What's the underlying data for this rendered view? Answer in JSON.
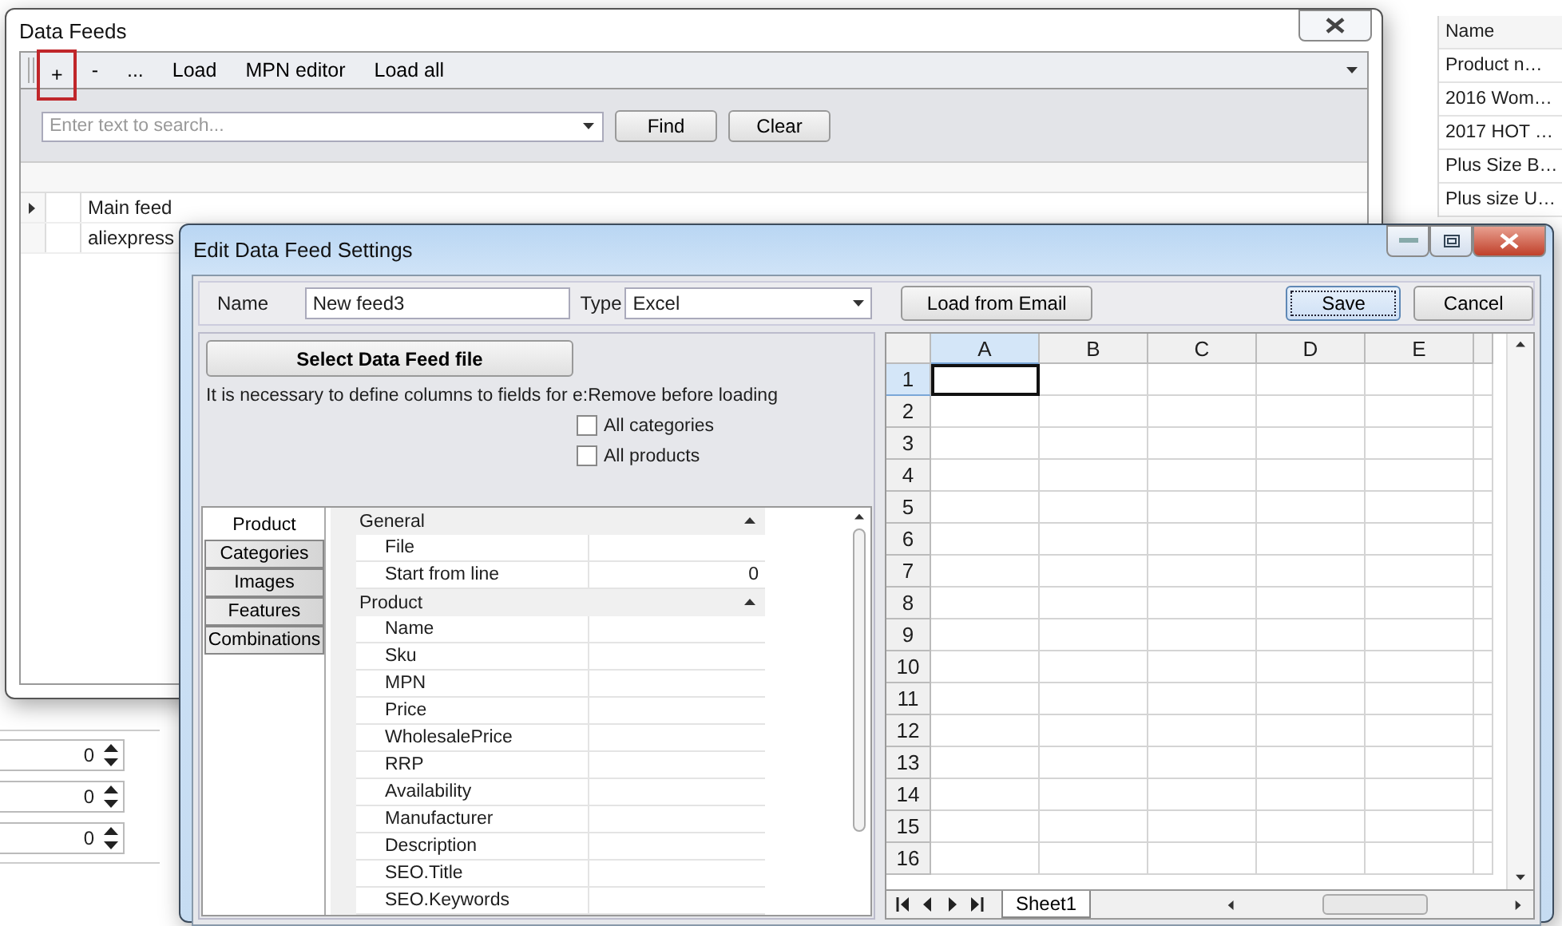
{
  "background": {
    "table": {
      "header": "Name",
      "cells": [
        "Product n…",
        "2016 Wom…",
        "2017 HOT …",
        "Plus Size B…",
        "Plus size U…"
      ]
    },
    "spinners": [
      {
        "value": "0"
      },
      {
        "value": "0"
      },
      {
        "value": "0"
      }
    ]
  },
  "data_feeds": {
    "title": "Data Feeds",
    "toolbar": [
      {
        "label": "+",
        "highlighted": true
      },
      {
        "label": "-",
        "highlighted": false
      },
      {
        "label": "...",
        "highlighted": false
      },
      {
        "label": "Load",
        "highlighted": false
      },
      {
        "label": "MPN editor",
        "highlighted": false
      },
      {
        "label": "Load all",
        "highlighted": false
      }
    ],
    "search": {
      "placeholder": "Enter text to search..."
    },
    "buttons": [
      "Find",
      "Clear"
    ],
    "rows": [
      {
        "name": "Main feed",
        "current": true
      },
      {
        "name": "aliexpress",
        "current": false
      }
    ]
  },
  "edit_window": {
    "title": "Edit Data Feed Settings",
    "name_label": "Name",
    "name_value": "New feed3",
    "type_label": "Type",
    "type_value": "Excel",
    "buttons": [
      {
        "label": "Load from Email",
        "focused": false
      },
      {
        "label": "Save",
        "focused": true
      },
      {
        "label": "Cancel",
        "focused": false
      }
    ],
    "select_file_button": "Select Data Feed file",
    "notice": "It is necessary to define columns to fields for e:",
    "remove_label": "Remove before loading",
    "checkboxes": [
      {
        "label": "All categories",
        "checked": false
      },
      {
        "label": "All products",
        "checked": false
      }
    ],
    "tabs": [
      {
        "label": "Product",
        "selected": true
      },
      {
        "label": "Categories",
        "selected": false
      },
      {
        "label": "Images",
        "selected": false
      },
      {
        "label": "Features",
        "selected": false
      },
      {
        "label": "Combinations",
        "selected": false
      }
    ],
    "property_groups": [
      {
        "title": "General",
        "expanded": true,
        "rows": [
          {
            "name": "File"
          },
          {
            "name": "Start from line",
            "value": "0"
          }
        ]
      },
      {
        "title": "Product",
        "expanded": true,
        "rows": [
          {
            "name": "Name"
          },
          {
            "name": "Sku"
          },
          {
            "name": "MPN"
          },
          {
            "name": "Price"
          },
          {
            "name": "WholesalePrice"
          },
          {
            "name": "RRP"
          },
          {
            "name": "Availability"
          },
          {
            "name": "Manufacturer"
          },
          {
            "name": "Description"
          },
          {
            "name": "SEO.Title"
          },
          {
            "name": "SEO.Keywords"
          }
        ]
      }
    ],
    "sheet": {
      "columns": [
        {
          "label": "A",
          "selected": true
        },
        {
          "label": "B",
          "selected": false
        },
        {
          "label": "C",
          "selected": false
        },
        {
          "label": "D",
          "selected": false
        },
        {
          "label": "E",
          "selected": false
        }
      ],
      "rows": [
        {
          "label": "1",
          "selected": true
        },
        {
          "label": "2",
          "selected": false
        },
        {
          "label": "3",
          "selected": false
        },
        {
          "label": "4",
          "selected": false
        },
        {
          "label": "5",
          "selected": false
        },
        {
          "label": "6",
          "selected": false
        },
        {
          "label": "7",
          "selected": false
        },
        {
          "label": "8",
          "selected": false
        },
        {
          "label": "9",
          "selected": false
        },
        {
          "label": "10",
          "selected": false
        },
        {
          "label": "11",
          "selected": false
        },
        {
          "label": "12",
          "selected": false
        },
        {
          "label": "13",
          "selected": false
        },
        {
          "label": "14",
          "selected": false
        },
        {
          "label": "15",
          "selected": false
        },
        {
          "label": "16",
          "selected": false
        }
      ],
      "sheet_tabs": [
        {
          "label": "Sheet1",
          "selected": true
        }
      ]
    }
  }
}
